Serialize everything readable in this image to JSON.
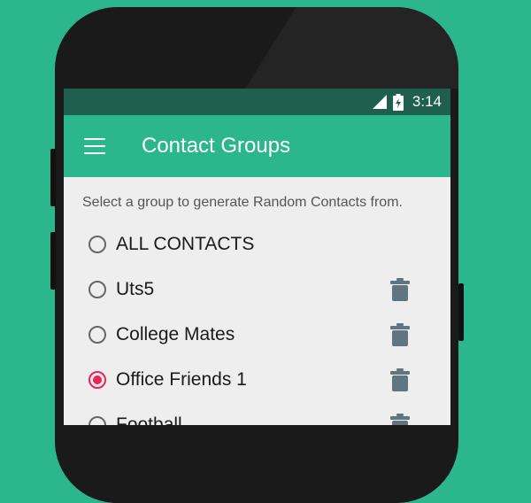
{
  "status_bar": {
    "time": "3:14"
  },
  "app_bar": {
    "title": "Contact Groups"
  },
  "hint": "Select a group to generate Random Contacts from.",
  "groups": [
    {
      "label": "ALL CONTACTS",
      "selected": false,
      "deletable": false
    },
    {
      "label": "Uts5",
      "selected": false,
      "deletable": true
    },
    {
      "label": "College Mates",
      "selected": false,
      "deletable": true
    },
    {
      "label": "Office Friends 1",
      "selected": true,
      "deletable": true
    },
    {
      "label": "Football",
      "selected": false,
      "deletable": true
    }
  ],
  "colors": {
    "background": "#2bb68c",
    "app_bar": "#2bb68c",
    "status_bar": "#1f5f4d",
    "radio_selected": "#ee2356",
    "trash_icon": "#5f7580"
  }
}
